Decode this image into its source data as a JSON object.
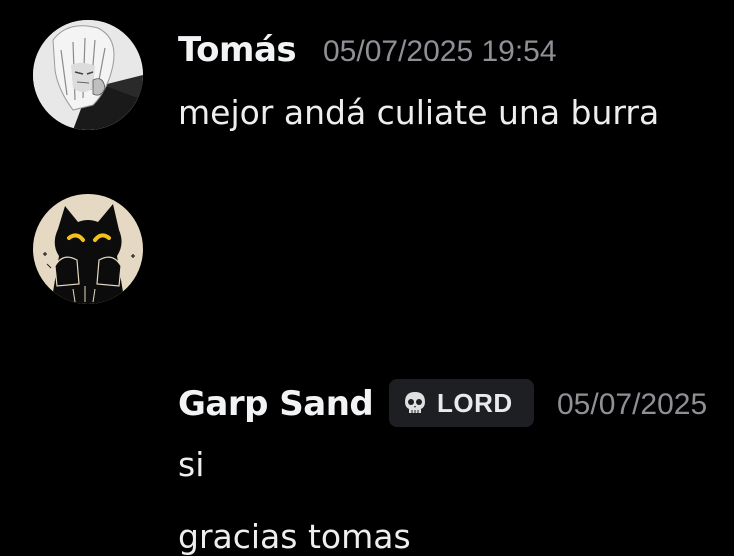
{
  "messages": [
    {
      "author": "Tomás",
      "timestamp": "05/07/2025 19:54",
      "avatar": "avatar-anime-white-hair",
      "lines": [
        "mejor andá culiate una burra"
      ]
    },
    {
      "author": "Garp Sand",
      "role": {
        "label": "LORD",
        "icon": "skull-icon"
      },
      "timestamp": "05/07/2025",
      "avatar": "avatar-black-cat",
      "lines": [
        "si",
        "gracias tomas"
      ]
    }
  ],
  "colors": {
    "background": "#000000",
    "username": "#f2f3f5",
    "timestamp": "#8e9096",
    "text": "#eeeef0",
    "badge_bg": "#1e1f22"
  }
}
